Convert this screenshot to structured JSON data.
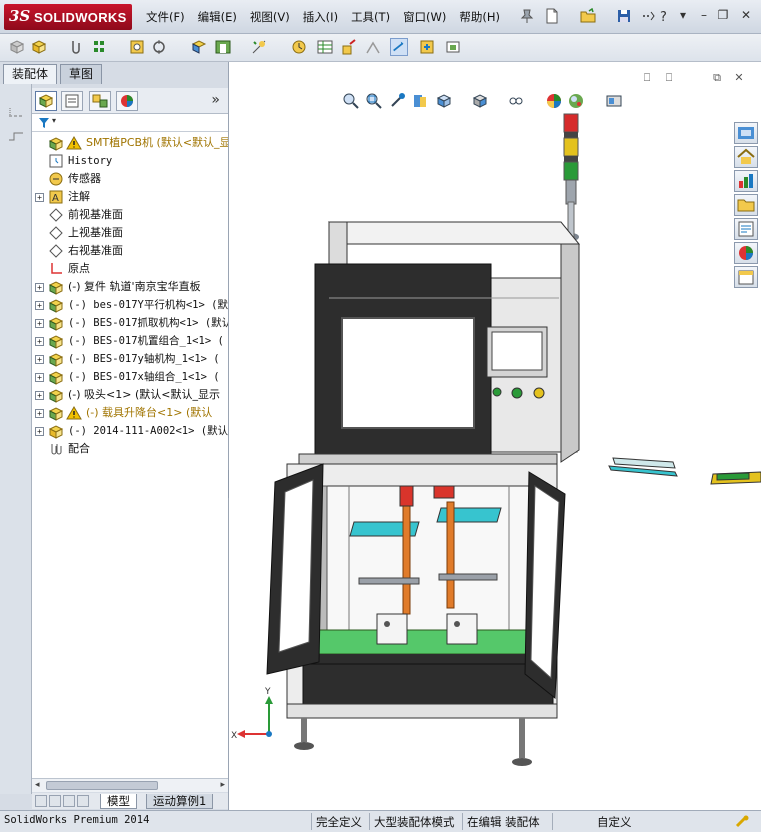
{
  "app": {
    "brand_mark": "3S",
    "brand_name": "SOLIDWORKS",
    "menus": [
      "文件(F)",
      "编辑(E)",
      "视图(V)",
      "插入(I)",
      "工具(T)",
      "窗口(W)",
      "帮助(H)"
    ]
  },
  "panel": {
    "tabs": [
      "装配体",
      "草图"
    ],
    "tree": [
      {
        "label": "SMT植PCB机  (默认<默认_显示",
        "icon": "assembly-warning-icon",
        "expandable": false,
        "warn": true
      },
      {
        "label": "History",
        "icon": "history-icon",
        "expandable": false,
        "mono": true
      },
      {
        "label": "传感器",
        "icon": "sensor-icon",
        "expandable": false
      },
      {
        "label": "注解",
        "icon": "annotation-icon",
        "expandable": true
      },
      {
        "label": "前视基准面",
        "icon": "plane-icon",
        "expandable": false
      },
      {
        "label": "上视基准面",
        "icon": "plane-icon",
        "expandable": false
      },
      {
        "label": "右视基准面",
        "icon": "plane-icon",
        "expandable": false
      },
      {
        "label": "原点",
        "icon": "origin-icon",
        "expandable": false
      },
      {
        "label": "(-) 复件 轨道'南京宝华直板",
        "icon": "subassembly-icon",
        "expandable": true
      },
      {
        "label": "(-) bes-017Y平行机构<1> (默",
        "icon": "subassembly-icon",
        "expandable": true,
        "mono": true
      },
      {
        "label": "(-) BES-017抓取机构<1> (默认",
        "icon": "subassembly-icon",
        "expandable": true,
        "mono": true
      },
      {
        "label": "(-) BES-017机置组合_1<1> (",
        "icon": "subassembly-icon",
        "expandable": true,
        "mono": true
      },
      {
        "label": "(-) BES-017y轴机构_1<1> (",
        "icon": "subassembly-icon",
        "expandable": true,
        "mono": true
      },
      {
        "label": "(-) BES-017x轴组合_1<1> (",
        "icon": "subassembly-icon",
        "expandable": true,
        "mono": true
      },
      {
        "label": "(-) 吸头<1> (默认<默认_显示",
        "icon": "subassembly-icon",
        "expandable": true
      },
      {
        "label": "(-) 载具升降台<1> (默认",
        "icon": "subassembly-warning-icon",
        "expandable": true,
        "warn": true
      },
      {
        "label": "(-) 2014-111-A002<1> (默认",
        "icon": "part-icon",
        "expandable": true,
        "mono": true
      },
      {
        "label": "配合",
        "icon": "mates-icon",
        "expandable": false
      }
    ],
    "bottom_tabs": [
      "模型",
      "运动算例1"
    ]
  },
  "status": {
    "product": "SolidWorks Premium 2014",
    "fully_defined": "完全定义",
    "large_assembly": "大型装配体模式",
    "editing": "在编辑 装配体",
    "custom": "自定义"
  },
  "colors": {
    "brand": "#c8152b",
    "machine_panel": "#e6e6e6",
    "screen_frame": "#2d2d2d",
    "accent_blue": "#1a78c2"
  }
}
